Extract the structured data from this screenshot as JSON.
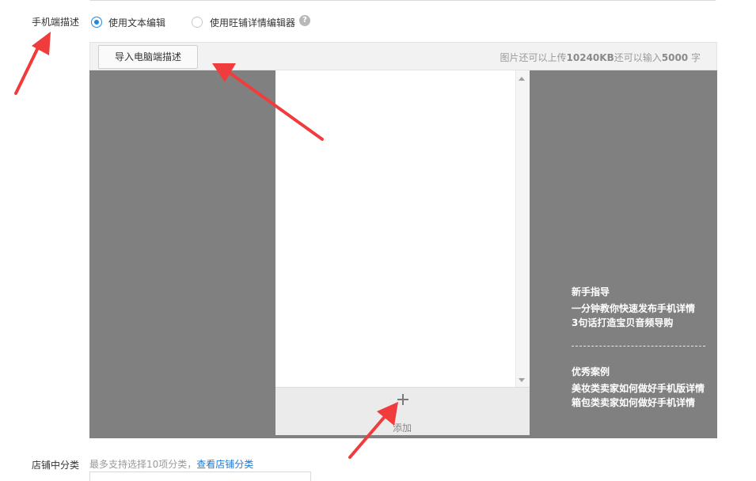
{
  "mobile_desc": {
    "label": "手机端描述",
    "radio_options": [
      {
        "label": "使用文本编辑",
        "checked": true
      },
      {
        "label": "使用旺铺详情编辑器",
        "checked": false
      }
    ],
    "help_icon": "?"
  },
  "toolbar": {
    "import_button": "导入电脑端描述",
    "quota_prefix": "图片还可以上传",
    "quota_size": "10240KB",
    "quota_mid": "还可以输入",
    "quota_chars": "5000",
    "quota_suffix": "字"
  },
  "editor": {
    "add_label": "添加"
  },
  "guide": {
    "title": "新手指导",
    "links": [
      "一分钟教你快速发布手机详情",
      "3句话打造宝贝音频导购"
    ],
    "cases_title": "优秀案例",
    "cases": [
      "美妆类卖家如何做好手机版详情",
      "箱包类卖家如何做好手机详情"
    ]
  },
  "store_category": {
    "label": "店铺中分类",
    "hint": "最多支持选择10项分类，",
    "link": "查看店铺分类"
  },
  "colors": {
    "accent": "#1e88e5",
    "link": "#1e78d2",
    "editor_bg": "#808080",
    "annotation_arrow": "#f03c3c"
  }
}
